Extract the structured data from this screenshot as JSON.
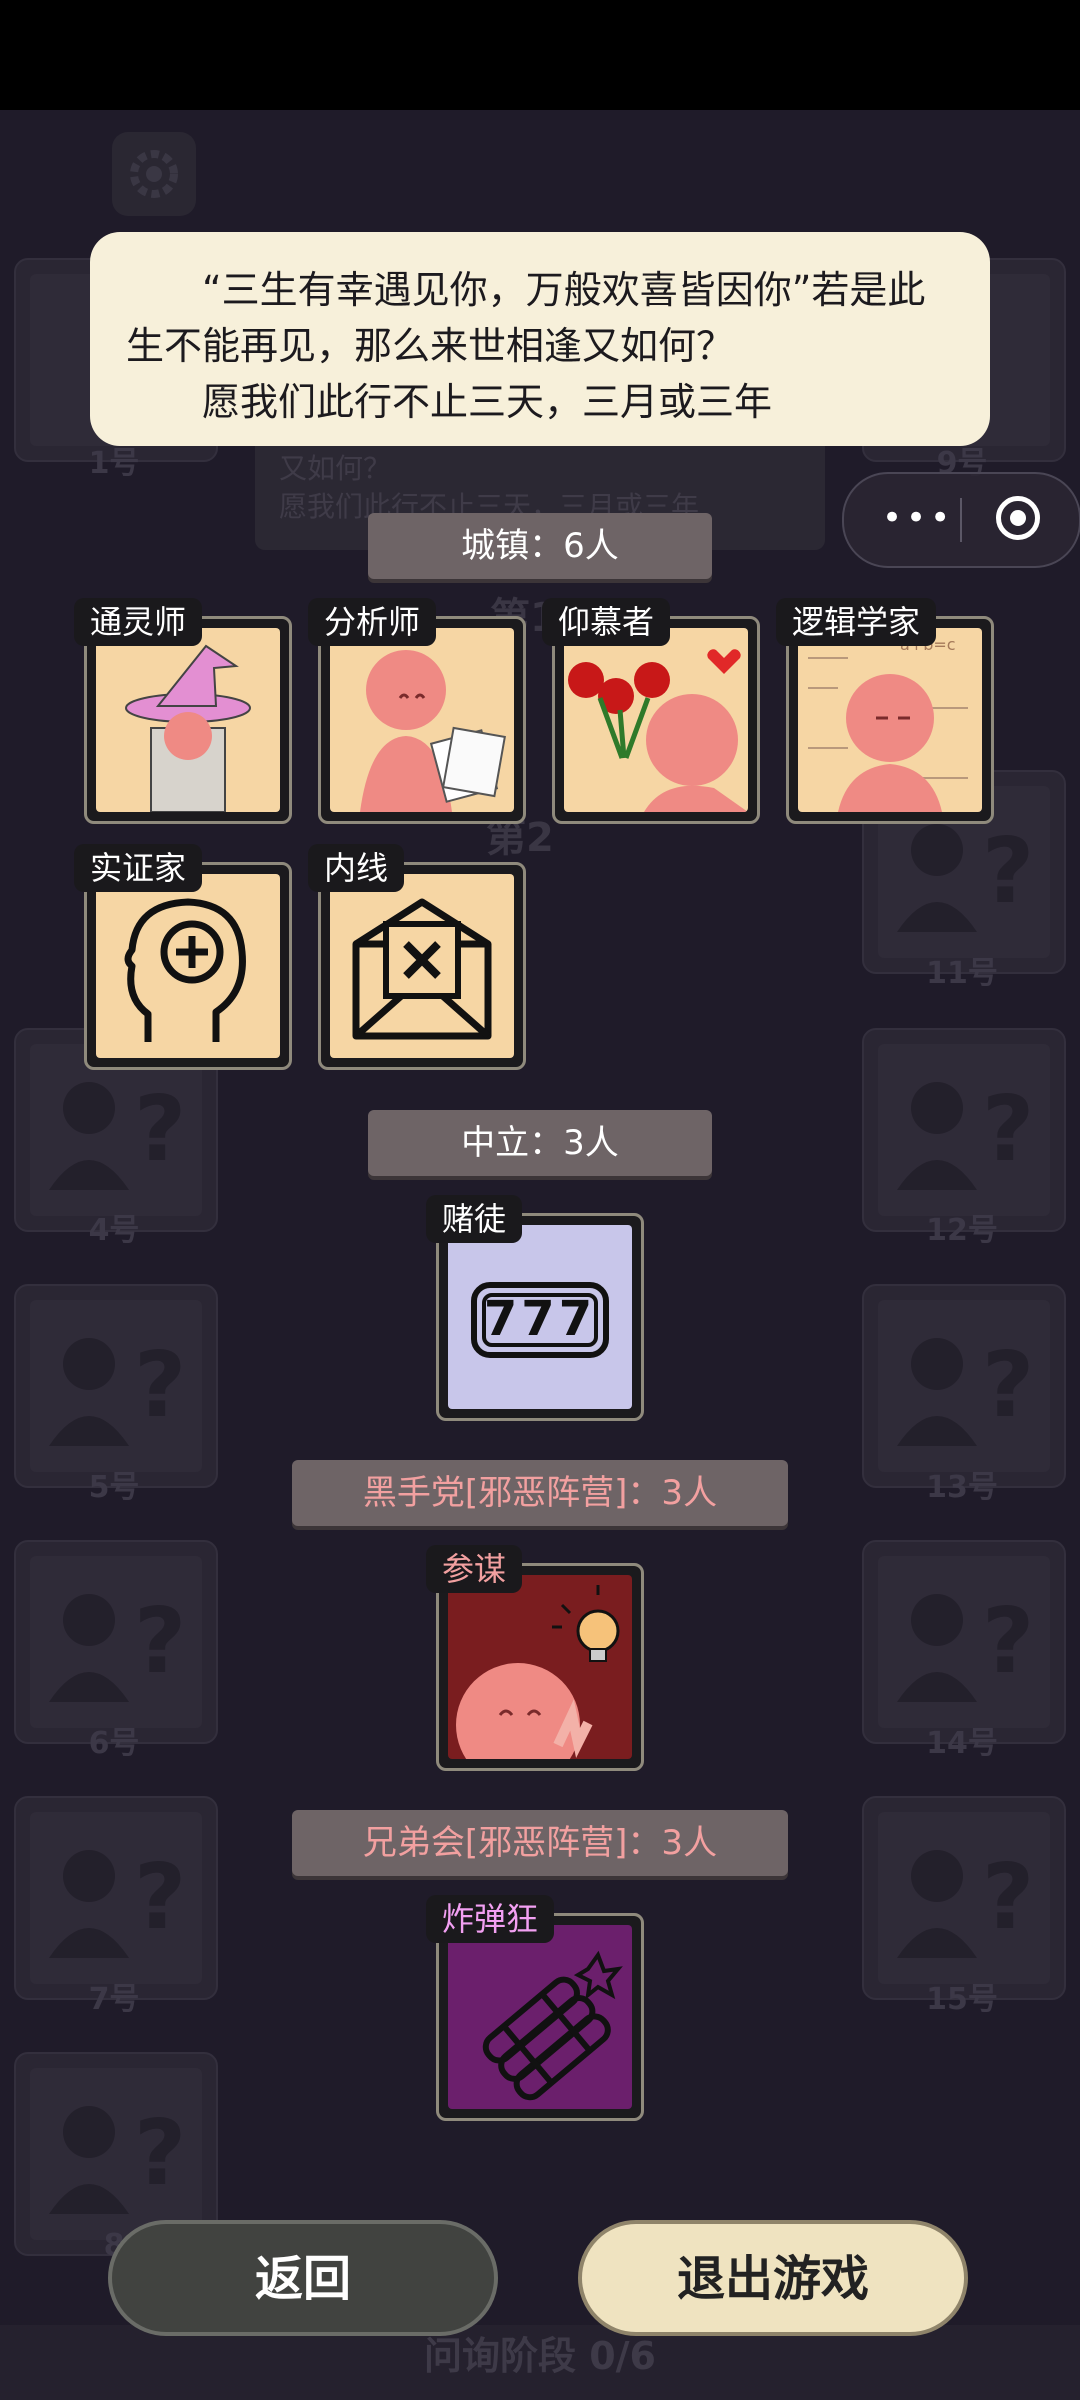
{
  "dialog": {
    "line1": "“三生有幸遇见你，万般欢喜皆因你”若是此生不能再见，那么来世相逢又如何？",
    "line2": "愿我们此行不止三天，三月或三年"
  },
  "background": {
    "bubble_line1": "又如何？",
    "bubble_line2": "愿我们此行不止三天，三月或三年",
    "round1": "第1",
    "round2": "第2",
    "slot_labels": [
      "1号",
      "4号",
      "5号",
      "6号",
      "7号",
      "8",
      "9号",
      "11号",
      "12号",
      "13号",
      "14号",
      "15号"
    ]
  },
  "groups": {
    "town": "城镇：6人",
    "neutral": "中立：3人",
    "blackhand": "黑手党[邪恶阵营]：3人",
    "brotherhood": "兄弟会[邪恶阵营]：3人"
  },
  "roles": {
    "medium": "通灵师",
    "analyst": "分析师",
    "admirer": "仰慕者",
    "logician": "逻辑学家",
    "empiricist": "实证家",
    "insider": "内线",
    "gambler": "赌徒",
    "strategist": "参谋",
    "bomber": "炸弹狂"
  },
  "slot_text": "777",
  "logic_text": "a+b=c",
  "buttons": {
    "back": "返回",
    "exit": "退出游戏"
  },
  "phase": "问询阶段 0/6",
  "colors": {
    "card_bg": "#f6d6a4",
    "neutral_bg": "#c8c6ea",
    "mafia_bg": "#7a1d1f",
    "brother_bg": "#6b1f6c",
    "pink_figure": "#ef8a84"
  }
}
